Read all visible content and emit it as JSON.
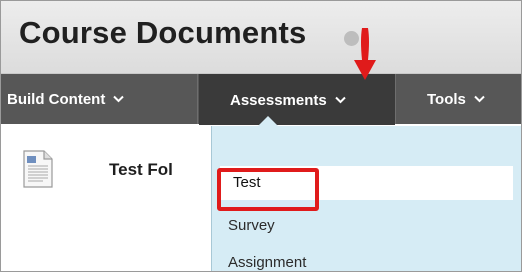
{
  "page": {
    "title": "Course Documents"
  },
  "nav": {
    "items": [
      {
        "label": "Build Content"
      },
      {
        "label": "Assessments"
      },
      {
        "label": "Tools"
      }
    ]
  },
  "content": {
    "folder_name": "Test Fol"
  },
  "dropdown": {
    "items": [
      {
        "label": "Test"
      },
      {
        "label": "Survey"
      },
      {
        "label": "Assignment"
      }
    ]
  },
  "colors": {
    "accent_red": "#e01b1b",
    "nav_bg": "#575757",
    "nav_active_bg": "#3a3a3a",
    "dropdown_bg": "#d6ecf5"
  }
}
